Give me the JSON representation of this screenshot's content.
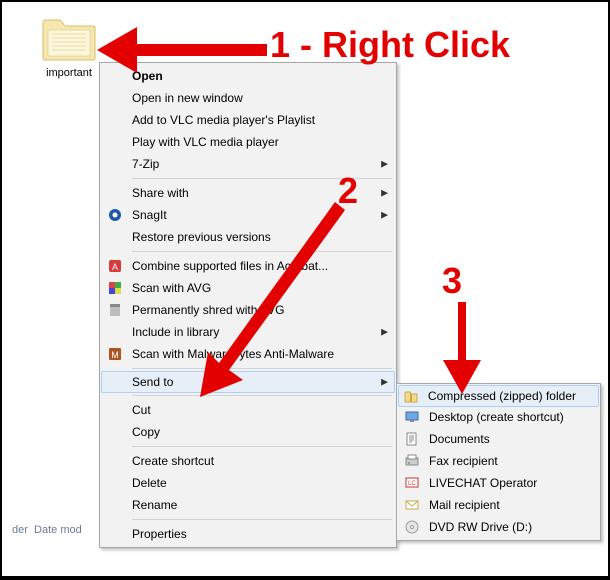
{
  "folder": {
    "name": "important"
  },
  "ctx_main": [
    {
      "label": "Open",
      "bold": true,
      "submenu": false,
      "icon": ""
    },
    {
      "label": "Open in new window",
      "submenu": false,
      "icon": ""
    },
    {
      "label": "Add to VLC media player's Playlist",
      "submenu": false,
      "icon": ""
    },
    {
      "label": "Play with VLC media player",
      "submenu": false,
      "icon": ""
    },
    {
      "label": "7-Zip",
      "submenu": true,
      "icon": ""
    },
    {
      "sep": true
    },
    {
      "label": "Share with",
      "submenu": true,
      "icon": ""
    },
    {
      "label": "SnagIt",
      "submenu": true,
      "icon": "snagit"
    },
    {
      "label": "Restore previous versions",
      "submenu": false,
      "icon": ""
    },
    {
      "sep": true
    },
    {
      "label": "Combine supported files in Acrobat...",
      "submenu": false,
      "icon": "acrobat"
    },
    {
      "label": "Scan with AVG",
      "submenu": false,
      "icon": "avg"
    },
    {
      "label": "Permanently shred with AVG",
      "submenu": false,
      "icon": "shred"
    },
    {
      "label": "Include in library",
      "submenu": true,
      "icon": ""
    },
    {
      "label": "Scan with Malwarebytes Anti-Malware",
      "submenu": false,
      "icon": "malware"
    },
    {
      "sep": true
    },
    {
      "label": "Send to",
      "submenu": true,
      "icon": "",
      "hover": true
    },
    {
      "sep": true
    },
    {
      "label": "Cut",
      "submenu": false,
      "icon": ""
    },
    {
      "label": "Copy",
      "submenu": false,
      "icon": ""
    },
    {
      "sep": true
    },
    {
      "label": "Create shortcut",
      "submenu": false,
      "icon": ""
    },
    {
      "label": "Delete",
      "submenu": false,
      "icon": ""
    },
    {
      "label": "Rename",
      "submenu": false,
      "icon": ""
    },
    {
      "sep": true
    },
    {
      "label": "Properties",
      "submenu": false,
      "icon": ""
    }
  ],
  "ctx_sendto": [
    {
      "label": "Compressed (zipped) folder",
      "icon": "zip",
      "hover": true
    },
    {
      "label": "Desktop (create shortcut)",
      "icon": "desktop"
    },
    {
      "label": "Documents",
      "icon": "doc"
    },
    {
      "label": "Fax recipient",
      "icon": "fax"
    },
    {
      "label": "LIVECHAT Operator",
      "icon": "lc"
    },
    {
      "label": "Mail recipient",
      "icon": "mail"
    },
    {
      "label": "DVD RW Drive (D:)",
      "icon": "dvd"
    }
  ],
  "annotations": {
    "a1": "1 - Right Click",
    "a2": "2",
    "a3": "3"
  },
  "footer": {
    "part1": "der",
    "part2": "Date mod"
  }
}
